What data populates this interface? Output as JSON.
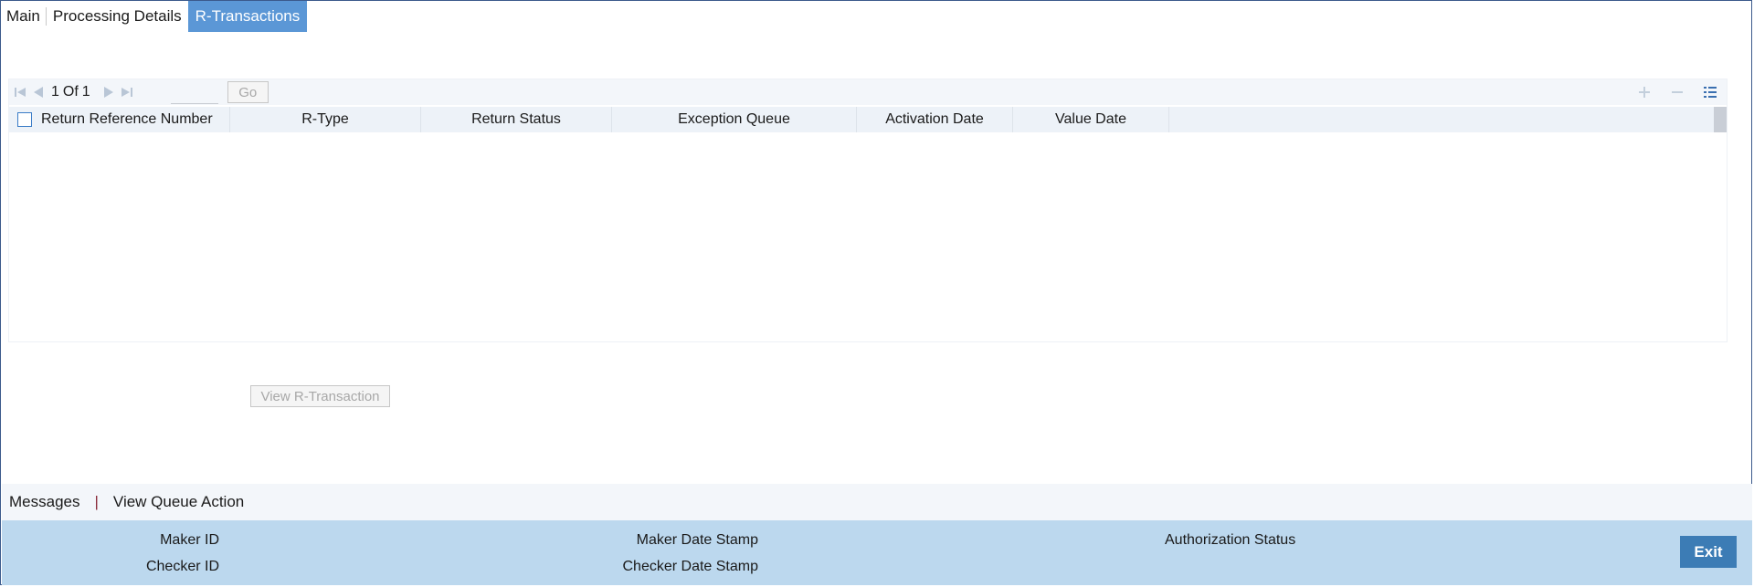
{
  "tabs": [
    {
      "label": "Main"
    },
    {
      "label": "Processing Details"
    },
    {
      "label": "R-Transactions"
    }
  ],
  "active_tab": "R-Transactions",
  "grid": {
    "pager": {
      "current_page": "1",
      "of_label": "Of",
      "total_pages": "1",
      "go_label": "Go"
    },
    "columns": [
      {
        "label": "Return Reference Number"
      },
      {
        "label": "R-Type"
      },
      {
        "label": "Return Status"
      },
      {
        "label": "Exception Queue"
      },
      {
        "label": "Activation Date"
      },
      {
        "label": "Value Date"
      }
    ],
    "rows": []
  },
  "buttons": {
    "view_rtxn_label": "View R-Transaction",
    "exit_label": "Exit"
  },
  "links": {
    "messages": "Messages",
    "separator": "|",
    "view_queue_action": "View Queue Action"
  },
  "audit": {
    "maker_id_label": "Maker ID",
    "checker_id_label": "Checker ID",
    "maker_date_label": "Maker Date Stamp",
    "checker_date_label": "Checker Date Stamp",
    "auth_status_label": "Authorization Status"
  },
  "colors": {
    "active_tab_bg": "#5b97d6",
    "footer_bg": "#bcd8ee",
    "exit_bg": "#3c7cb5",
    "link_separator": "#8a2b3a"
  }
}
